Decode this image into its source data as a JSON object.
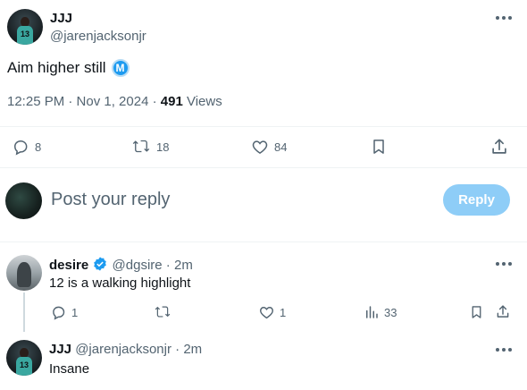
{
  "main_tweet": {
    "author_name": "JJJ",
    "author_handle": "@jarenjacksonjr",
    "text": "Aim higher still",
    "badge_letter": "M",
    "timestamp": "12:25 PM · Nov 1, 2024 · ",
    "views_count": "491",
    "views_label": " Views",
    "replies": "8",
    "reposts": "18",
    "likes": "84"
  },
  "composer": {
    "placeholder": "Post your reply",
    "reply_label": "Reply"
  },
  "replies": [
    {
      "author_name": "desire",
      "author_handle": "@dgsire",
      "time": " · 2m",
      "text": "12 is a walking highlight",
      "replies": "1",
      "likes": "1",
      "views": "33"
    },
    {
      "author_name": "JJJ",
      "author_handle": "@jarenjacksonjr",
      "time": " · 2m",
      "text": "Insane"
    }
  ],
  "colors": {
    "accent": "#1d9bf0",
    "reply_button_disabled": "#8ecdf7",
    "muted_text": "#536471",
    "divider": "#eff3f4"
  },
  "avatar_jersey_number": "13"
}
